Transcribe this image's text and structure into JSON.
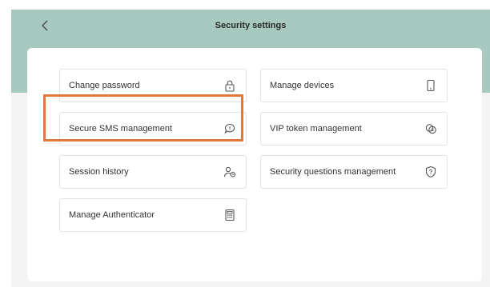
{
  "header": {
    "title": "Security settings",
    "back_icon": "chevron-left-icon"
  },
  "options": [
    {
      "label": "Change password",
      "icon": "lock-icon"
    },
    {
      "label": "Manage devices",
      "icon": "phone-icon"
    },
    {
      "label": "Secure SMS management",
      "icon": "chat-bubble-icon"
    },
    {
      "label": "VIP token management",
      "icon": "token-icon"
    },
    {
      "label": "Session history",
      "icon": "user-history-icon"
    },
    {
      "label": "Security questions management",
      "icon": "shield-question-icon"
    },
    {
      "label": "Manage Authenticator",
      "icon": "calculator-icon"
    }
  ],
  "colors": {
    "header": "#a8c9c0",
    "highlight": "#e07a3a"
  }
}
